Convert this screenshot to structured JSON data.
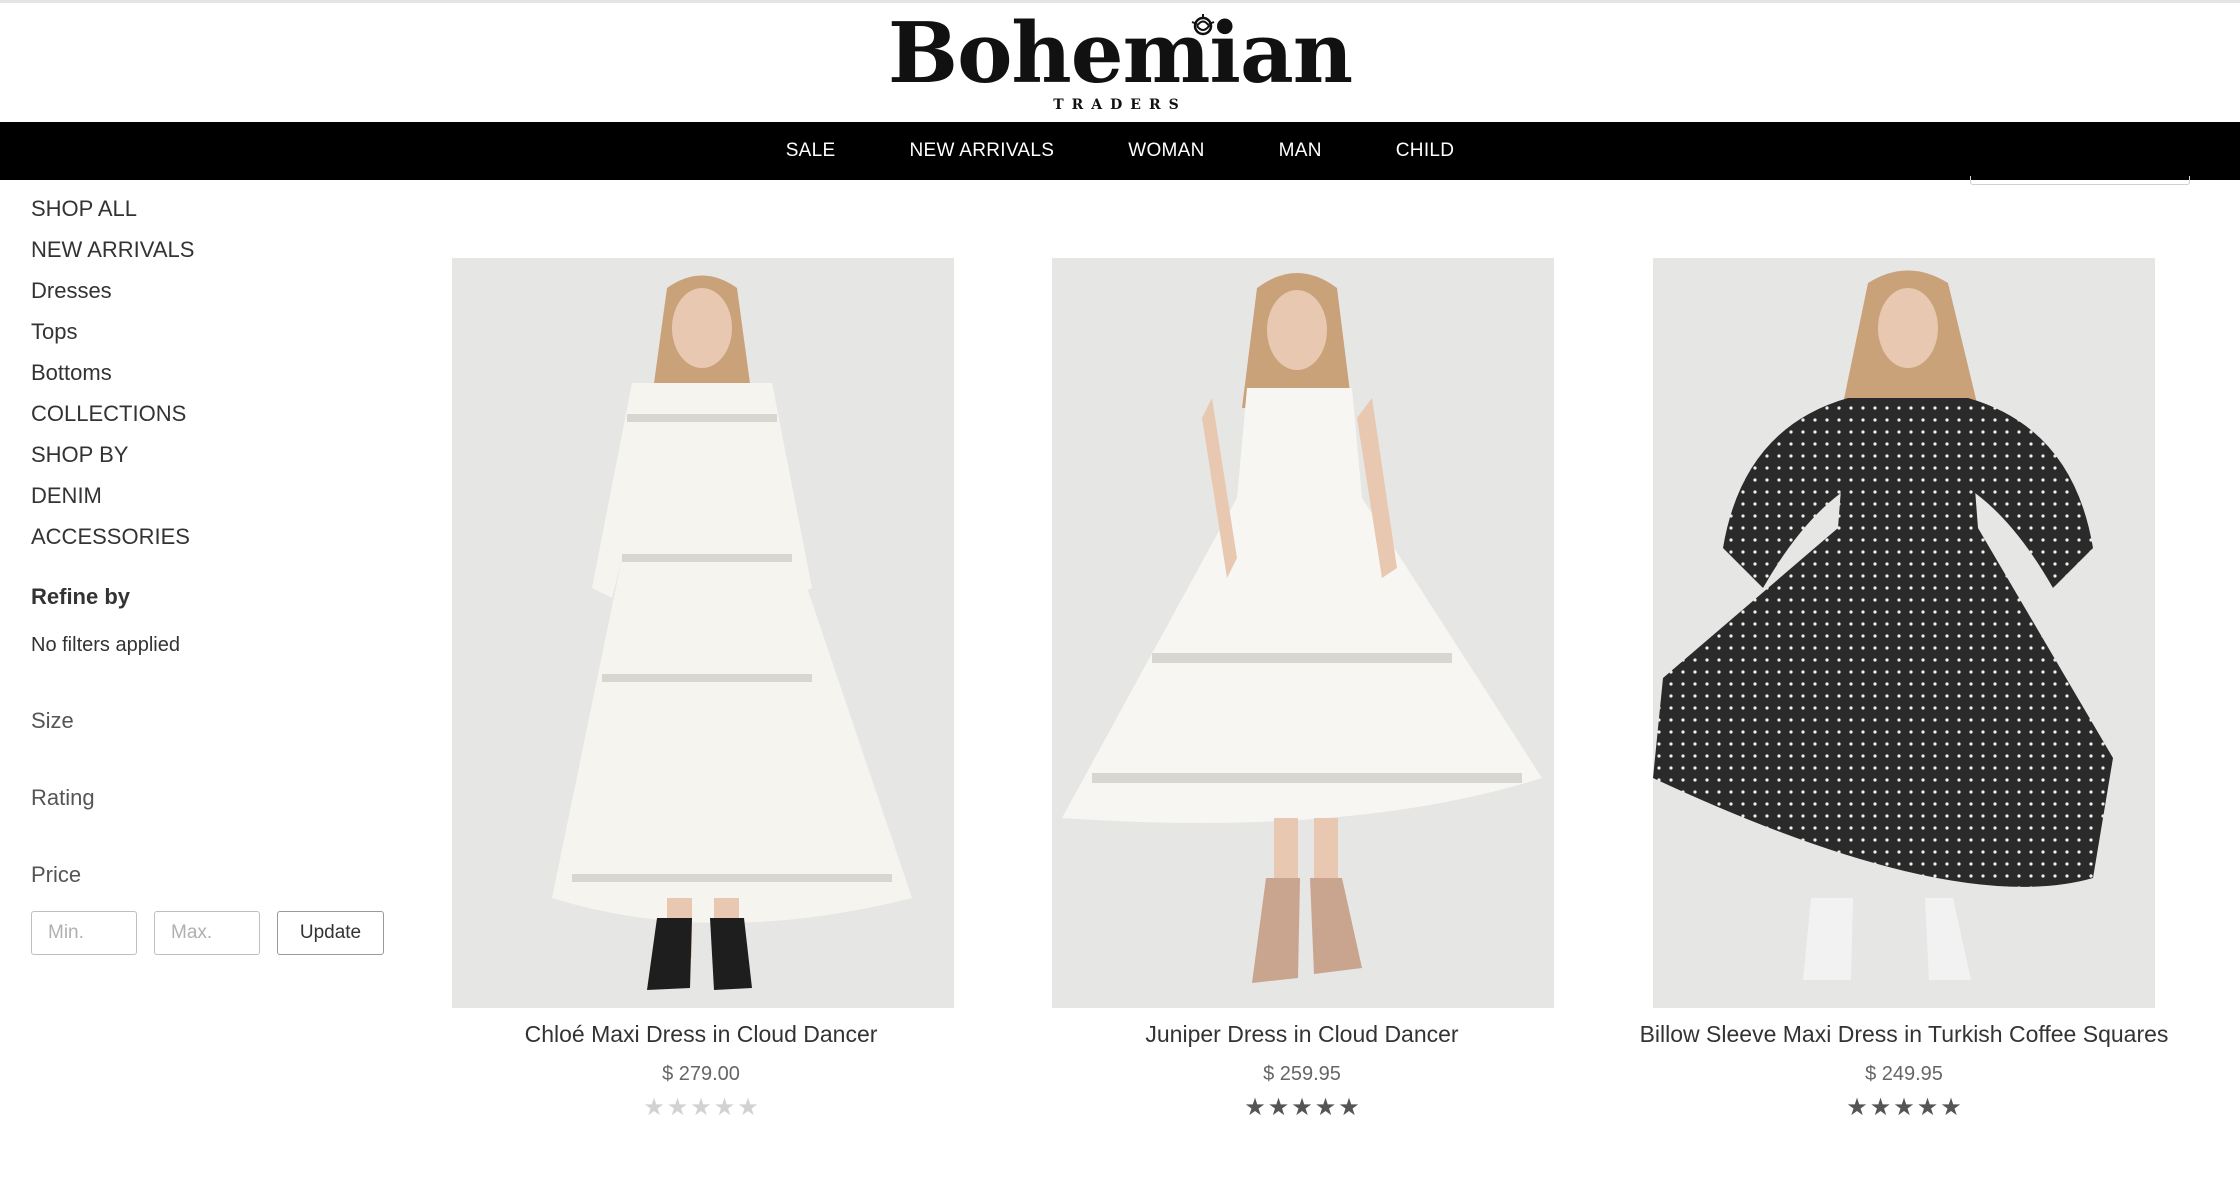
{
  "brand": {
    "name": "Bohemian",
    "subtitle": "TRADERS"
  },
  "nav": [
    "SALE",
    "NEW ARRIVALS",
    "WOMAN",
    "MAN",
    "CHILD"
  ],
  "sidebar": {
    "categories": [
      "SHOP ALL",
      "NEW ARRIVALS",
      "Dresses",
      "Tops",
      "Bottoms",
      "COLLECTIONS",
      "SHOP BY",
      "DENIM",
      "ACCESSORIES"
    ],
    "refine_title": "Refine by",
    "no_filters": "No filters applied",
    "facets": {
      "size": "Size",
      "rating": "Rating",
      "price": "Price"
    },
    "price": {
      "min_placeholder": "Min.",
      "max_placeholder": "Max.",
      "update_label": "Update"
    }
  },
  "products": [
    {
      "name": "Chloé Maxi Dress in Cloud Dancer",
      "price": "$ 279.00",
      "rating": 0,
      "max_rating": 5,
      "dress_color": "#f6f4ef",
      "boot_color": "#1e1e1e"
    },
    {
      "name": "Juniper Dress in Cloud Dancer",
      "price": "$ 259.95",
      "rating": 5,
      "max_rating": 5,
      "dress_color": "#f7f6f2",
      "boot_color": "#c9a58f"
    },
    {
      "name": "Billow Sleeve Maxi Dress in Turkish Coffee Squares",
      "price": "$ 249.95",
      "rating": 5,
      "max_rating": 5,
      "dress_color": "#2a2a2a",
      "boot_color": "#f2f2f2"
    }
  ],
  "colors": {
    "nav_bg": "#000000",
    "image_bg": "#e6e6e4",
    "hair": "#c9a27a"
  }
}
